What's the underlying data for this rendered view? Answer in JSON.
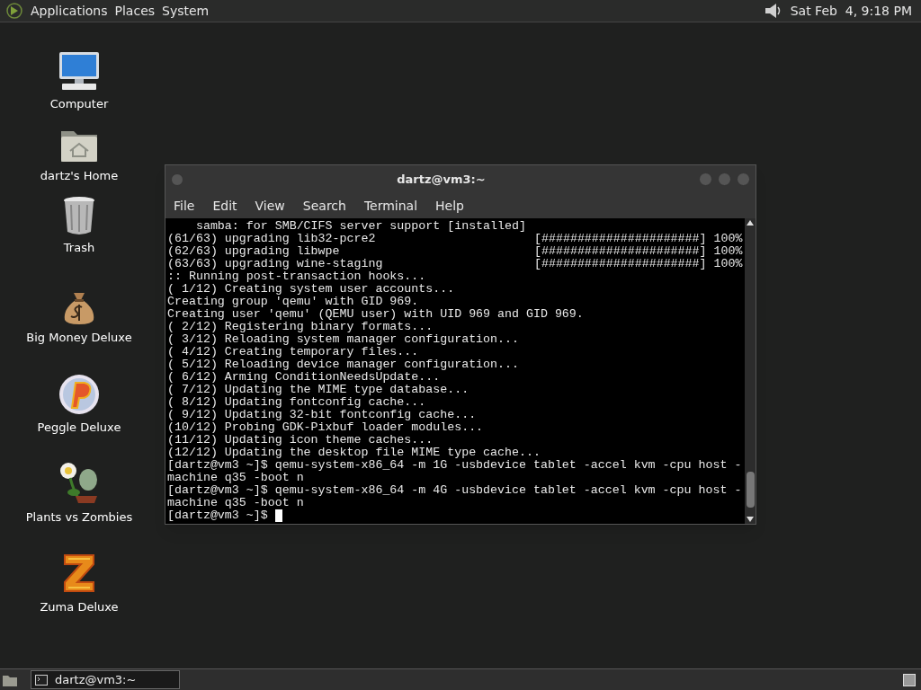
{
  "top_panel": {
    "menus": [
      "Applications",
      "Places",
      "System"
    ],
    "clock": "Sat Feb  4, 9:18 PM"
  },
  "desktop_icons": [
    {
      "kind": "computer",
      "label": "Computer"
    },
    {
      "kind": "home",
      "label": "dartz's Home"
    },
    {
      "kind": "trash",
      "label": "Trash"
    },
    {
      "kind": "moneybag",
      "label": "Big Money Deluxe"
    },
    {
      "kind": "peggle",
      "label": "Peggle Deluxe"
    },
    {
      "kind": "plant",
      "label": "Plants vs Zombies"
    },
    {
      "kind": "zuma",
      "label": "Zuma Deluxe"
    }
  ],
  "window": {
    "title": "dartz@vm3:~",
    "menu": [
      "File",
      "Edit",
      "View",
      "Search",
      "Terminal",
      "Help"
    ],
    "lines": [
      {
        "kind": "text",
        "text": "    samba: for SMB/CIFS server support [installed]"
      },
      {
        "kind": "progress",
        "text": "(61/63) upgrading lib32-pcre2",
        "bar": "[######################]",
        "percent": "100%"
      },
      {
        "kind": "progress",
        "text": "(62/63) upgrading libwpe",
        "bar": "[######################]",
        "percent": "100%"
      },
      {
        "kind": "progress",
        "text": "(63/63) upgrading wine-staging",
        "bar": "[######################]",
        "percent": "100%"
      },
      {
        "kind": "text",
        "text": ":: Running post-transaction hooks..."
      },
      {
        "kind": "text",
        "text": "( 1/12) Creating system user accounts..."
      },
      {
        "kind": "text",
        "text": "Creating group 'qemu' with GID 969."
      },
      {
        "kind": "text",
        "text": "Creating user 'qemu' (QEMU user) with UID 969 and GID 969."
      },
      {
        "kind": "text",
        "text": "( 2/12) Registering binary formats..."
      },
      {
        "kind": "text",
        "text": "( 3/12) Reloading system manager configuration..."
      },
      {
        "kind": "text",
        "text": "( 4/12) Creating temporary files..."
      },
      {
        "kind": "text",
        "text": "( 5/12) Reloading device manager configuration..."
      },
      {
        "kind": "text",
        "text": "( 6/12) Arming ConditionNeedsUpdate..."
      },
      {
        "kind": "text",
        "text": "( 7/12) Updating the MIME type database..."
      },
      {
        "kind": "text",
        "text": "( 8/12) Updating fontconfig cache..."
      },
      {
        "kind": "text",
        "text": "( 9/12) Updating 32-bit fontconfig cache..."
      },
      {
        "kind": "text",
        "text": "(10/12) Probing GDK-Pixbuf loader modules..."
      },
      {
        "kind": "text",
        "text": "(11/12) Updating icon theme caches..."
      },
      {
        "kind": "text",
        "text": "(12/12) Updating the desktop file MIME type cache..."
      },
      {
        "kind": "text",
        "text": "[dartz@vm3 ~]$ qemu-system-x86_64 -m 1G -usbdevice tablet -accel kvm -cpu host -"
      },
      {
        "kind": "text",
        "text": "machine q35 -boot n"
      },
      {
        "kind": "text",
        "text": "[dartz@vm3 ~]$ qemu-system-x86_64 -m 4G -usbdevice tablet -accel kvm -cpu host -"
      },
      {
        "kind": "text",
        "text": "machine q35 -boot n"
      },
      {
        "kind": "prompt",
        "text": "[dartz@vm3 ~]$ "
      }
    ]
  },
  "taskbar": {
    "tasks": [
      {
        "label": "dartz@vm3:~",
        "selected": true
      }
    ]
  }
}
